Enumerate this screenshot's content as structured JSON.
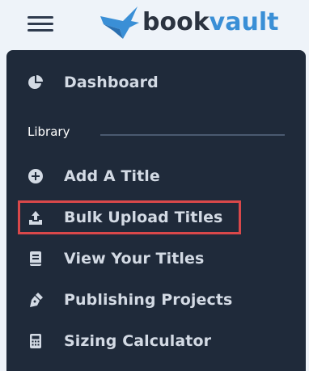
{
  "brand": {
    "name_part1": "book",
    "name_part2": "vault"
  },
  "sidebar": {
    "items_top": [
      {
        "label": "Dashboard",
        "icon": "pie-chart-icon"
      }
    ],
    "section": {
      "label": "Library"
    },
    "items": [
      {
        "label": "Add A Title",
        "icon": "plus-circle-icon"
      },
      {
        "label": "Bulk Upload Titles",
        "icon": "upload-icon",
        "highlighted": true
      },
      {
        "label": "View Your Titles",
        "icon": "book-icon"
      },
      {
        "label": "Publishing Projects",
        "icon": "pen-nib-icon"
      },
      {
        "label": "Sizing Calculator",
        "icon": "calculator-icon"
      }
    ]
  },
  "colors": {
    "sidebar_bg": "#1f2a3a",
    "text": "#d3dae4",
    "brand_accent": "#3a8fd6",
    "highlight_border": "#d9484a"
  }
}
